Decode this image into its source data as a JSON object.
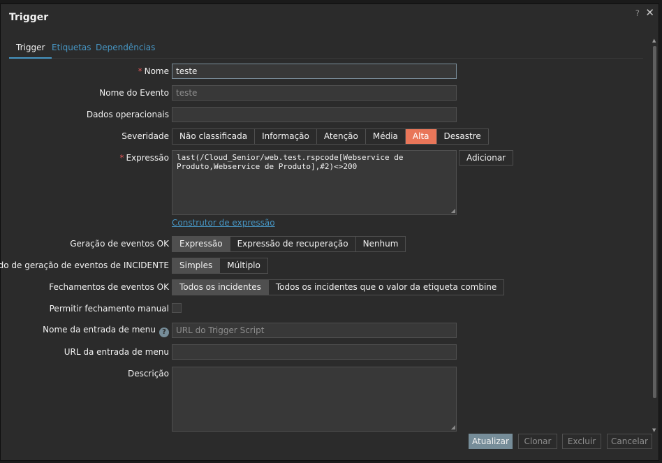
{
  "dialog": {
    "title": "Trigger"
  },
  "tabs": [
    {
      "label": "Trigger",
      "active": true
    },
    {
      "label": "Etiquetas"
    },
    {
      "label": "Dependências"
    }
  ],
  "form": {
    "nome": {
      "label": "Nome",
      "required": "*",
      "value": "teste"
    },
    "nome_evento": {
      "label": "Nome do Evento",
      "placeholder": "teste"
    },
    "dados_operacionais": {
      "label": "Dados operacionais",
      "value": ""
    },
    "severidade": {
      "label": "Severidade",
      "options": [
        "Não classificada",
        "Informação",
        "Atenção",
        "Média",
        "Alta",
        "Desastre"
      ],
      "selected": "Alta"
    },
    "expressao": {
      "label": "Expressão",
      "required": "*",
      "value": "last(/Cloud_Senior/web.test.rspcode[Webservice de Produto,Webservice de Produto],#2)<>200",
      "add_button": "Adicionar",
      "builder_link": "Construtor de expressão"
    },
    "geracao_ok": {
      "label": "Geração de eventos OK",
      "options": [
        "Expressão",
        "Expressão de recuperação",
        "Nenhum"
      ],
      "selected": "Expressão"
    },
    "modo_incidente": {
      "label": "Modo de geração de eventos de INCIDENTE",
      "options": [
        "Simples",
        "Múltiplo"
      ],
      "selected": "Simples"
    },
    "fechamento_ok": {
      "label": "Fechamentos de eventos OK",
      "options": [
        "Todos os incidentes",
        "Todos os incidentes que o valor da etiqueta combine"
      ],
      "selected": "Todos os incidentes"
    },
    "fechamento_manual": {
      "label": "Permitir fechamento manual",
      "checked": false
    },
    "nome_menu": {
      "label": "Nome da entrada de menu",
      "help": "?",
      "placeholder": "URL do Trigger Script"
    },
    "url_menu": {
      "label": "URL da entrada de menu",
      "value": ""
    },
    "descricao": {
      "label": "Descrição",
      "value": ""
    }
  },
  "footer": {
    "update": "Atualizar",
    "clone": "Clonar",
    "delete": "Excluir",
    "cancel": "Cancelar"
  },
  "icons": {
    "help": "?",
    "close": "✕"
  },
  "colors": {
    "accent": "#4796c4",
    "severity_high": "#e97659",
    "required": "#e45959",
    "primary_button": "#768d99"
  }
}
